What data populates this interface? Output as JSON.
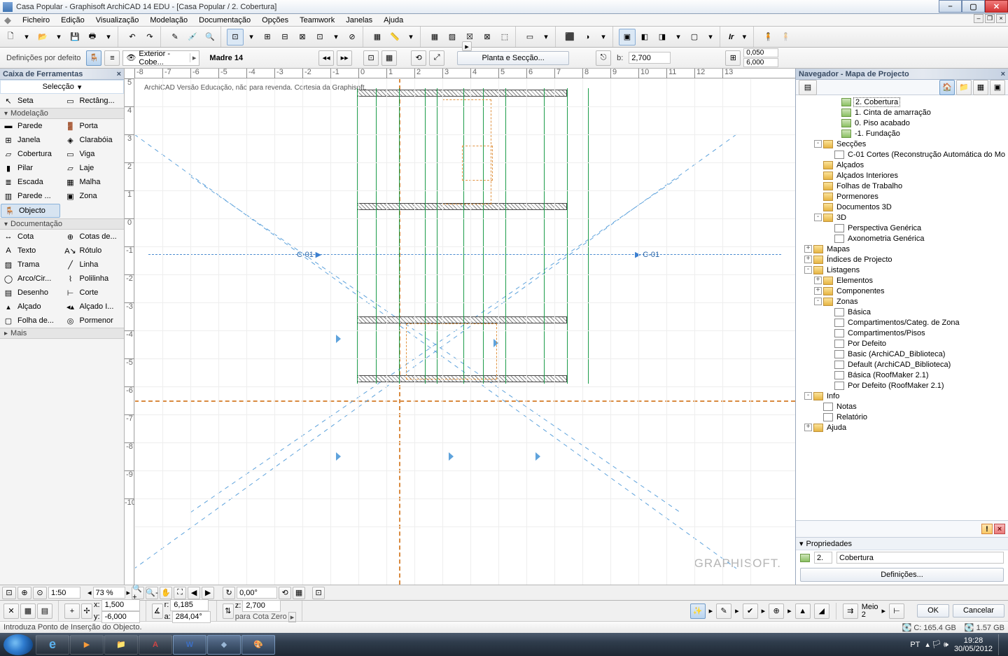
{
  "title_bar": {
    "text": "Casa Popular - Graphisoft ArchiCAD 14 EDU - [Casa Popular / 2. Cobertura]"
  },
  "menu": [
    "Ficheiro",
    "Edição",
    "Visualização",
    "Modelação",
    "Documentação",
    "Opções",
    "Teamwork",
    "Janelas",
    "Ajuda"
  ],
  "info_bar": {
    "defaults": "Definições por defeito",
    "layer_combo": "Exterior - Cobe...",
    "name_label": "Madre 14",
    "plan_button": "Planta e Secção...",
    "b_val": "2,700",
    "coord1": "0,050",
    "coord2": "6,000",
    "b_label": "b:"
  },
  "toolbox": {
    "title": "Caixa de Ferramentas",
    "sel_head": "Selecção",
    "sel_items": [
      [
        "Seta",
        "Rectâng..."
      ]
    ],
    "model_head": "Modelação",
    "model_items": [
      [
        "Parede",
        "Porta"
      ],
      [
        "Janela",
        "Clarabóia"
      ],
      [
        "Cobertura",
        "Viga"
      ],
      [
        "Pilar",
        "Laje"
      ],
      [
        "Escada",
        "Malha"
      ],
      [
        "Parede ...",
        "Zona"
      ]
    ],
    "object": "Objecto",
    "doc_head": "Documentação",
    "doc_items": [
      [
        "Cota",
        "Cotas de..."
      ],
      [
        "Texto",
        "Rótulo"
      ],
      [
        "Trama",
        "Linha"
      ],
      [
        "Arco/Cir...",
        "Polilinha"
      ],
      [
        "Desenho",
        "Corte"
      ],
      [
        "Alçado",
        "Alçado I..."
      ],
      [
        "Folha de...",
        "Pormenor"
      ]
    ],
    "more": "Mais"
  },
  "canvas": {
    "edu_text": "ArchiCAD Versão Educação, não para revenda. Cortesia da Graphisoft.",
    "logo": "GRAPHISOFT.",
    "section_left": "C-01",
    "section_right": "C-01",
    "ruler_h": [
      "-8",
      "-7",
      "-6",
      "-5",
      "-4",
      "-3",
      "-2",
      "-1",
      "0",
      "1",
      "2",
      "3",
      "4",
      "5",
      "6",
      "7",
      "8",
      "9",
      "10",
      "11",
      "12",
      "13"
    ],
    "ruler_v": [
      "5",
      "4",
      "3",
      "2",
      "1",
      "0",
      "-1",
      "-2",
      "-3",
      "-4",
      "-5",
      "-6",
      "-7",
      "-8",
      "-9",
      "-10"
    ]
  },
  "navigator": {
    "title": "Navegador - Mapa de Projecto",
    "tree": [
      {
        "ind": 46,
        "icon": "ic-story",
        "label": "2. Cobertura",
        "sel": true
      },
      {
        "ind": 46,
        "icon": "ic-story",
        "label": "1. Cinta de amarração"
      },
      {
        "ind": 46,
        "icon": "ic-story",
        "label": "0. Piso acabado"
      },
      {
        "ind": 46,
        "icon": "ic-story",
        "label": "-1. Fundação"
      },
      {
        "ind": 20,
        "exp": "-",
        "icon": "ic-folder",
        "label": "Secções"
      },
      {
        "ind": 36,
        "icon": "ic-doc",
        "label": "C-01 Cortes (Reconstrução Automática do Mo"
      },
      {
        "ind": 20,
        "icon": "ic-folder",
        "label": "Alçados"
      },
      {
        "ind": 20,
        "icon": "ic-folder",
        "label": "Alçados Interiores"
      },
      {
        "ind": 20,
        "icon": "ic-folder",
        "label": "Folhas de Trabalho"
      },
      {
        "ind": 20,
        "icon": "ic-folder",
        "label": "Pormenores"
      },
      {
        "ind": 20,
        "icon": "ic-folder",
        "label": "Documentos 3D"
      },
      {
        "ind": 20,
        "exp": "-",
        "icon": "ic-folder",
        "label": "3D"
      },
      {
        "ind": 36,
        "icon": "ic-doc",
        "label": "Perspectiva Genérica"
      },
      {
        "ind": 36,
        "icon": "ic-doc",
        "label": "Axonometria Genérica"
      },
      {
        "ind": 6,
        "exp": "+",
        "icon": "ic-folder",
        "label": "Mapas"
      },
      {
        "ind": 6,
        "exp": "+",
        "icon": "ic-folder",
        "label": "Índices de Projecto"
      },
      {
        "ind": 6,
        "exp": "-",
        "icon": "ic-folder",
        "label": "Listagens"
      },
      {
        "ind": 20,
        "exp": "+",
        "icon": "ic-folder",
        "label": "Elementos"
      },
      {
        "ind": 20,
        "exp": "+",
        "icon": "ic-folder",
        "label": "Componentes"
      },
      {
        "ind": 20,
        "exp": "-",
        "icon": "ic-folder",
        "label": "Zonas"
      },
      {
        "ind": 36,
        "icon": "ic-doc",
        "label": "Básica"
      },
      {
        "ind": 36,
        "icon": "ic-doc",
        "label": "Compartimentos/Categ. de Zona"
      },
      {
        "ind": 36,
        "icon": "ic-doc",
        "label": "Compartimentos/Pisos"
      },
      {
        "ind": 36,
        "icon": "ic-doc",
        "label": "Por Defeito"
      },
      {
        "ind": 36,
        "icon": "ic-doc",
        "label": "Basic (ArchiCAD_Biblioteca)"
      },
      {
        "ind": 36,
        "icon": "ic-doc",
        "label": "Default (ArchiCAD_Biblioteca)"
      },
      {
        "ind": 36,
        "icon": "ic-doc",
        "label": "Básica (RoofMaker 2.1)"
      },
      {
        "ind": 36,
        "icon": "ic-doc",
        "label": "Por Defeito (RoofMaker 2.1)"
      },
      {
        "ind": 6,
        "exp": "-",
        "icon": "ic-folder",
        "label": "Info"
      },
      {
        "ind": 20,
        "icon": "ic-doc",
        "label": "Notas"
      },
      {
        "ind": 20,
        "icon": "ic-doc",
        "label": "Relatório"
      },
      {
        "ind": 6,
        "exp": "+",
        "icon": "ic-folder",
        "label": "Ajuda"
      }
    ],
    "props_head": "Propriedades",
    "prop_id": "2.",
    "prop_name": "Cobertura",
    "defs_btn": "Definições..."
  },
  "bottom": {
    "scale": "1:50",
    "zoom": "73 %",
    "angle": "0,00°"
  },
  "coord": {
    "x": "1,500",
    "y": "-6,000",
    "r": "6,185",
    "a": "284,04°",
    "z": "2,700",
    "z_label": "para Cota Zero",
    "meio": "Meio",
    "meio_n": "2",
    "ok": "OK",
    "cancel": "Cancelar",
    "xl": "x:",
    "yl": "y:",
    "rl": "r:",
    "al": "a:",
    "zl": "z:"
  },
  "status": {
    "msg": "Introduza Ponto de Inserção do Objecto.",
    "disk_c": "C: 165.4 GB",
    "disk_d": "1.57 GB",
    "lang": "PT"
  },
  "clock": {
    "time": "19:28",
    "date": "30/05/2012"
  }
}
